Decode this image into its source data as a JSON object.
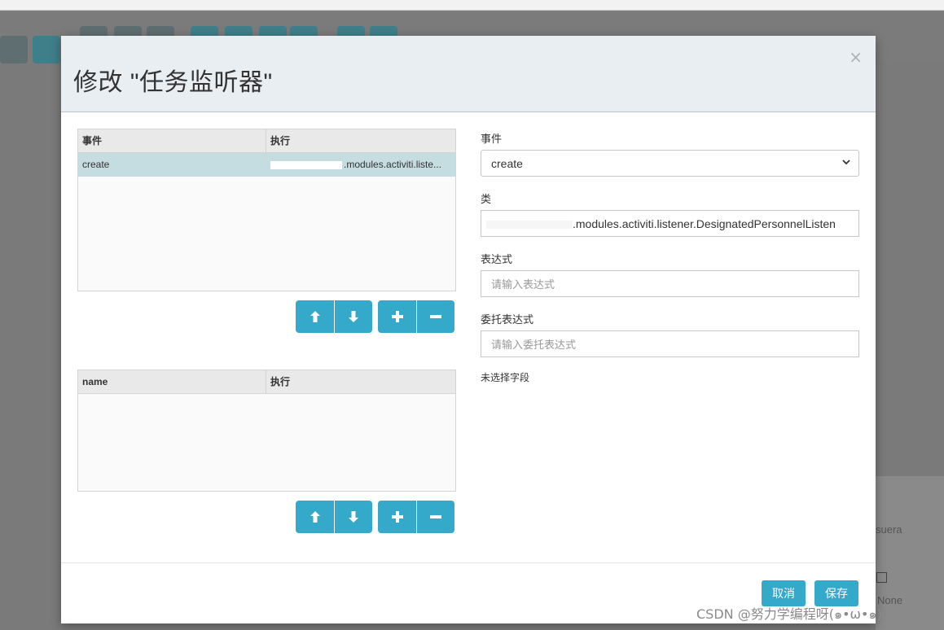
{
  "modal": {
    "title": "修改 \"任务监听器\"",
    "close_label": "×",
    "listener_grid": {
      "columns": [
        "事件",
        "执行"
      ],
      "rows": [
        {
          "event": "create",
          "impl": ".modules.activiti.liste..."
        }
      ]
    },
    "field_grid": {
      "columns": [
        "name",
        "执行"
      ],
      "rows": []
    },
    "form": {
      "event_label": "事件",
      "event_value": "create",
      "class_label": "类",
      "class_value": ".modules.activiti.listener.DesignatedPersonnelListen",
      "expression_label": "表达式",
      "expression_placeholder": "请输入表达式",
      "delegate_label": "委托表达式",
      "delegate_placeholder": "请输入委托表达式",
      "no_field_text": "未选择字段"
    },
    "footer": {
      "cancel_label": "取消",
      "save_label": "保存"
    }
  },
  "background": {
    "text1": "suera",
    "text2": "None"
  },
  "watermark": "CSDN @努力学编程呀(๑•ω•๑)"
}
